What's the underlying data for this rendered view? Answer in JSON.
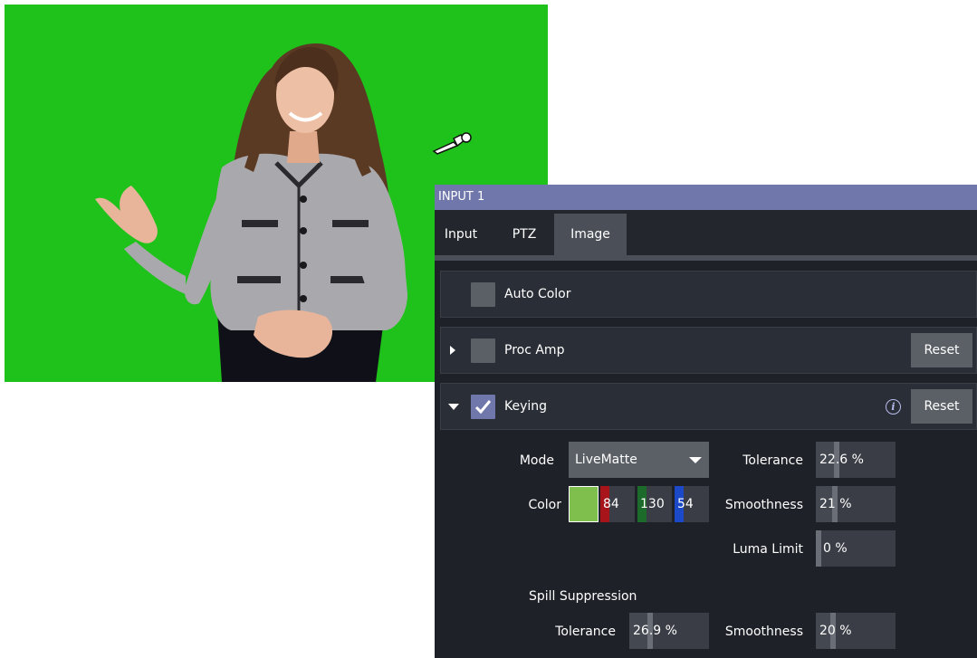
{
  "panel": {
    "title": "INPUT 1",
    "tabs": [
      {
        "label": "Input"
      },
      {
        "label": "PTZ"
      },
      {
        "label": "Image"
      }
    ]
  },
  "sections": {
    "auto_color": {
      "label": "Auto Color",
      "checked": false
    },
    "proc_amp": {
      "label": "Proc Amp",
      "checked": false,
      "reset_label": "Reset"
    },
    "keying": {
      "label": "Keying",
      "checked": true,
      "reset_label": "Reset"
    }
  },
  "keying": {
    "mode_label": "Mode",
    "mode_value": "LiveMatte",
    "color_label": "Color",
    "color_hex": "#7fbf4e",
    "color_r": "84",
    "color_g": "130",
    "color_b": "54",
    "tolerance_label": "Tolerance",
    "tolerance_value": "22.6 %",
    "smoothness_label": "Smoothness",
    "smoothness_value": "21 %",
    "luma_limit_label": "Luma Limit",
    "luma_limit_value": "0 %",
    "spill_label": "Spill Suppression",
    "spill_tolerance_label": "Tolerance",
    "spill_tolerance_value": "26.9 %",
    "spill_smoothness_label": "Smoothness",
    "spill_smoothness_value": "20 %"
  },
  "colors": {
    "chroma_green": "#1fc11b",
    "title_bar": "#6f77ab",
    "panel_bg": "#1e2128",
    "red_channel": "#a7151b",
    "green_channel": "#1c6b2a",
    "blue_channel": "#1c49c7"
  },
  "icons": {
    "eyedropper": "eyedropper-icon",
    "info": "info-icon",
    "check": "check-icon"
  }
}
